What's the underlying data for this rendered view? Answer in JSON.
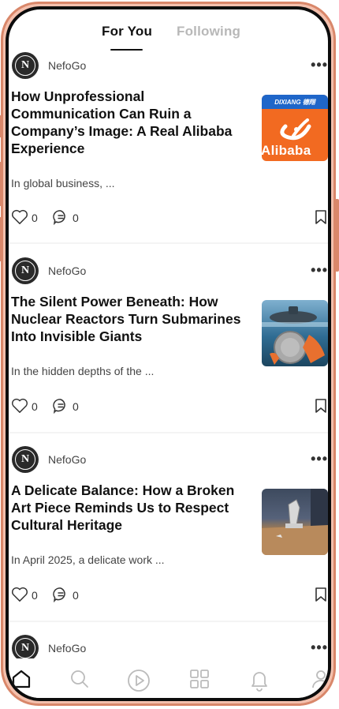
{
  "tabs": [
    {
      "label": "For You",
      "active": true
    },
    {
      "label": "Following",
      "active": false
    }
  ],
  "posts": [
    {
      "author": "NefoGo",
      "avatar_letter": "N",
      "title": "How Unprofessional Communication Can Ruin a Company’s Image: A Real Alibaba Experience",
      "snippet": "In global business, ...",
      "likes": "0",
      "comments": "0",
      "thumb": "alibaba-logo",
      "thumb_text": "Alibaba",
      "thumb_top_text": "DIXIANG 德翔"
    },
    {
      "author": "NefoGo",
      "avatar_letter": "N",
      "title": "The Silent Power Beneath: How Nuclear Reactors Turn Submarines Into Invisible Giants",
      "snippet": "In the hidden depths of the ...",
      "likes": "0",
      "comments": "0",
      "thumb": "submarine-photo"
    },
    {
      "author": "NefoGo",
      "avatar_letter": "N",
      "title": "A Delicate Balance: How a Broken Art Piece Reminds Us to Respect Cultural Heritage",
      "snippet": "In April 2025, a delicate work ...",
      "likes": "0",
      "comments": "0",
      "thumb": "broken-art-photo"
    },
    {
      "author": "NefoGo",
      "avatar_letter": "N"
    }
  ],
  "bottom_nav": [
    {
      "icon": "home-icon"
    },
    {
      "icon": "search-icon"
    },
    {
      "icon": "play-icon"
    },
    {
      "icon": "grid-icon"
    },
    {
      "icon": "bell-icon"
    },
    {
      "icon": "profile-icon"
    }
  ],
  "colors": {
    "frame_accent": "#d9876a",
    "alibaba_orange": "#f26a21",
    "text_primary": "#111111",
    "tab_inactive": "#b8b8b8"
  }
}
